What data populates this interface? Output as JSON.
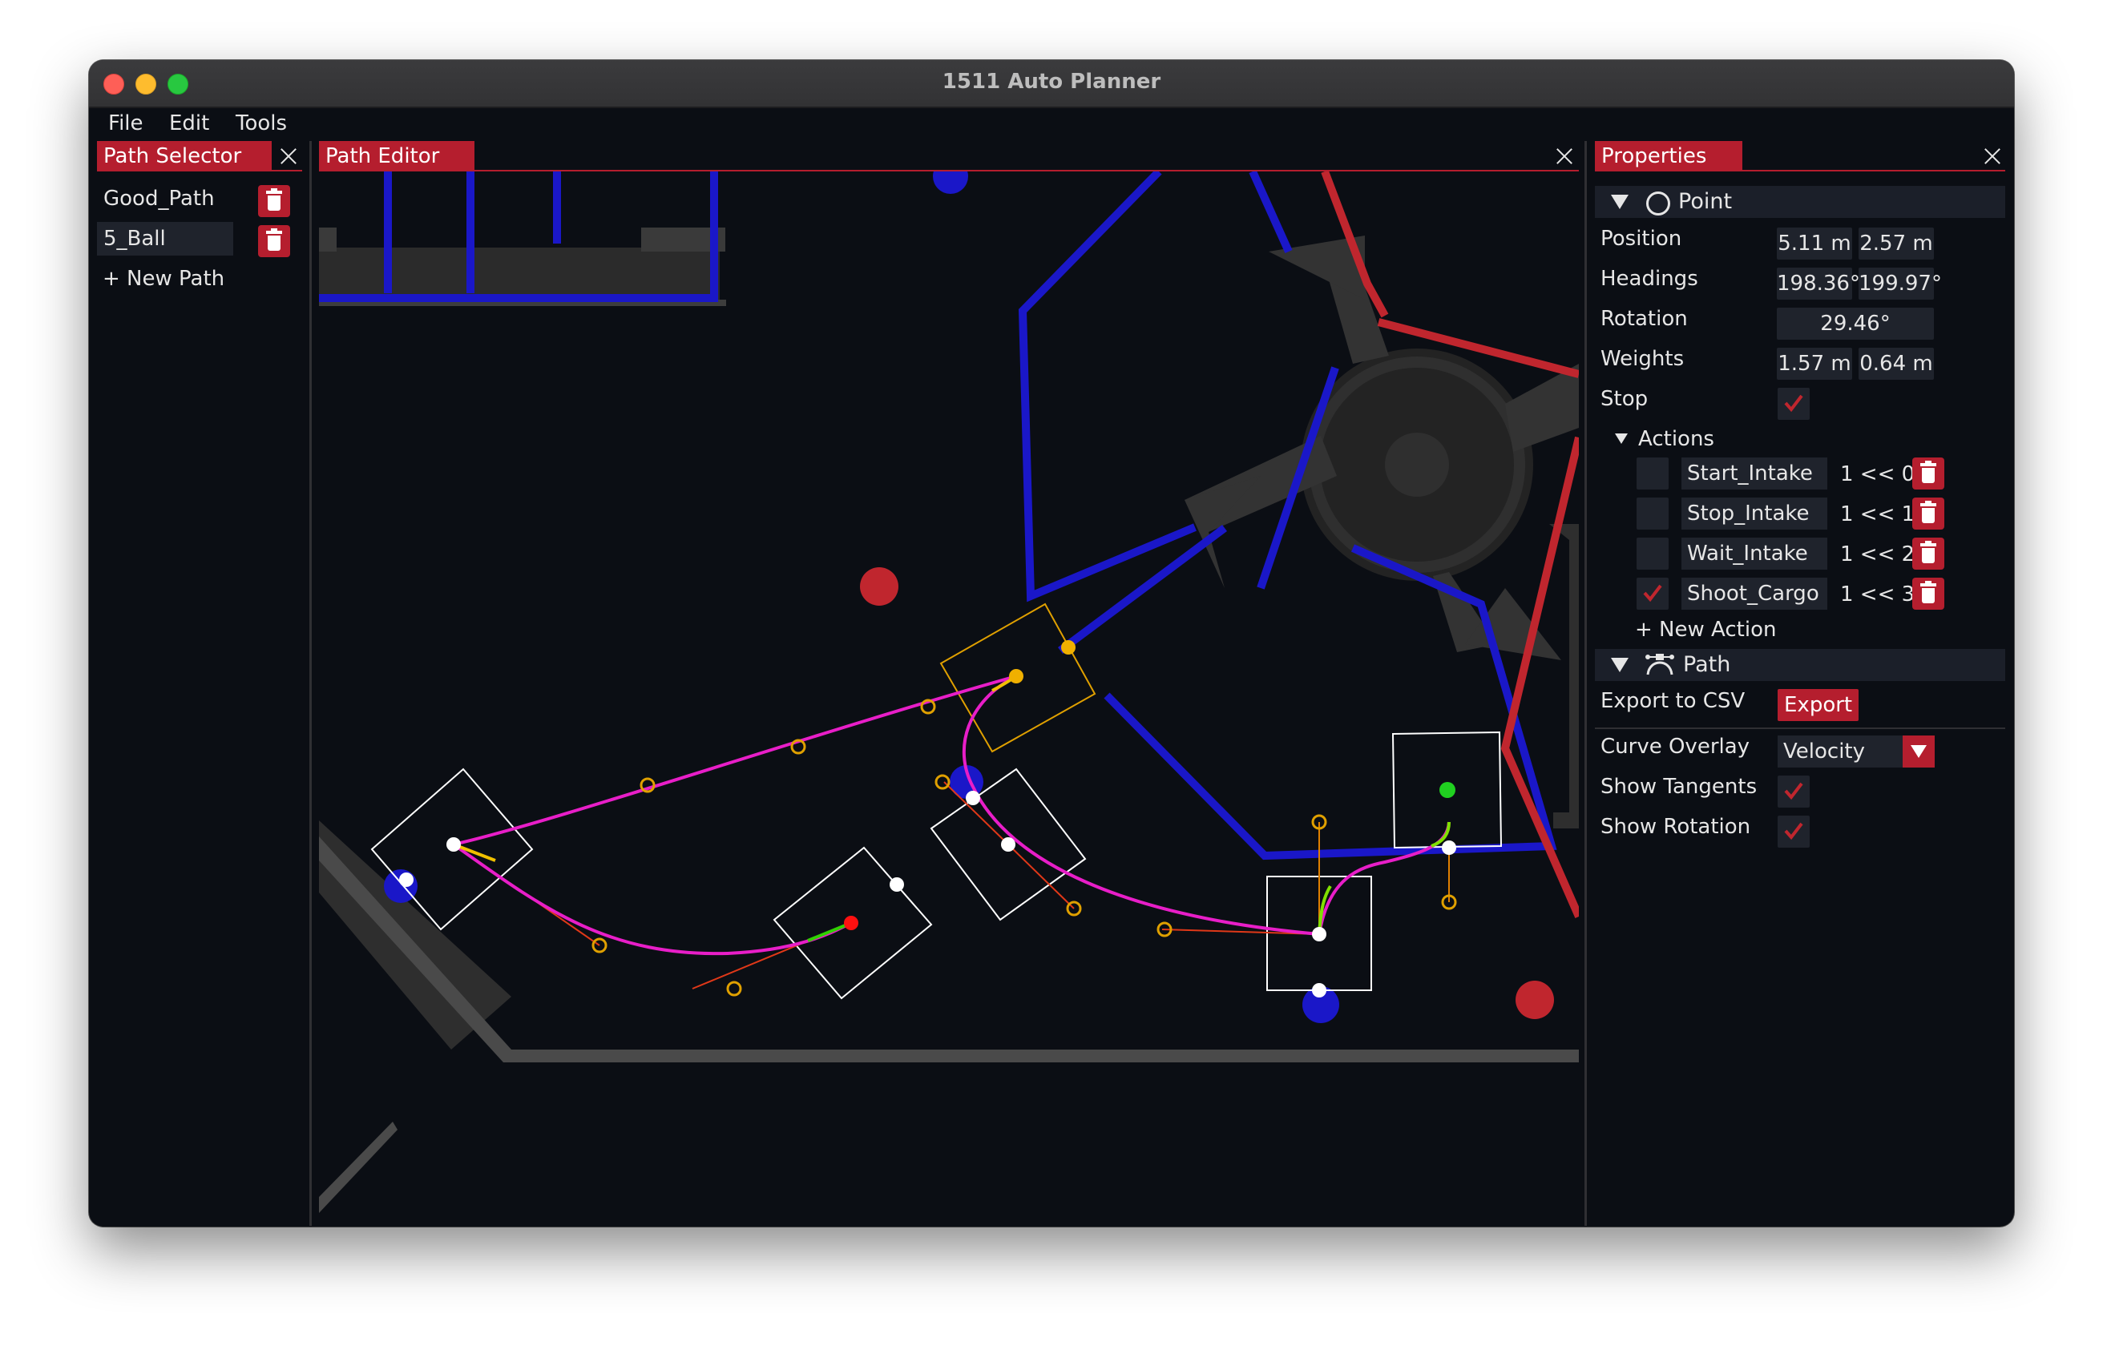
{
  "window": {
    "title": "1511 Auto Planner"
  },
  "menu": {
    "file": "File",
    "edit": "Edit",
    "tools": "Tools"
  },
  "path_selector": {
    "tab": "Path Selector",
    "paths": [
      "Good_Path",
      "5_Ball"
    ],
    "selected": "5_Ball",
    "new_path": "+ New Path"
  },
  "path_editor": {
    "tab": "Path Editor"
  },
  "properties": {
    "tab": "Properties",
    "point": {
      "header": "Point",
      "position_label": "Position",
      "position_x": "5.11 m",
      "position_y": "2.57 m",
      "headings_label": "Headings",
      "heading_in": "198.36°",
      "heading_out": "199.97°",
      "rotation_label": "Rotation",
      "rotation": "29.46°",
      "weights_label": "Weights",
      "weight_in": "1.57 m",
      "weight_out": "0.64 m",
      "stop_label": "Stop",
      "stop_checked": true
    },
    "actions": {
      "header": "Actions",
      "items": [
        {
          "checked": false,
          "name": "Start_Intake",
          "bit": "1 << 0"
        },
        {
          "checked": false,
          "name": "Stop_Intake",
          "bit": "1 << 1"
        },
        {
          "checked": false,
          "name": "Wait_Intake",
          "bit": "1 << 2"
        },
        {
          "checked": true,
          "name": "Shoot_Cargo",
          "bit": "1 << 3"
        }
      ],
      "new_action": "+ New Action"
    },
    "path": {
      "header": "Path",
      "export_label": "Export to CSV",
      "export_button": "Export",
      "curve_overlay_label": "Curve Overlay",
      "curve_overlay_value": "Velocity",
      "show_tangents_label": "Show Tangents",
      "show_tangents": true,
      "show_rotation_label": "Show Rotation",
      "show_rotation": true
    }
  },
  "colors": {
    "accent": "#b51e2e",
    "field_blue": "#1a17c8",
    "field_red": "#c0262e",
    "path_magenta": "#e81ec8",
    "control_point_orange": "#e0a000"
  }
}
